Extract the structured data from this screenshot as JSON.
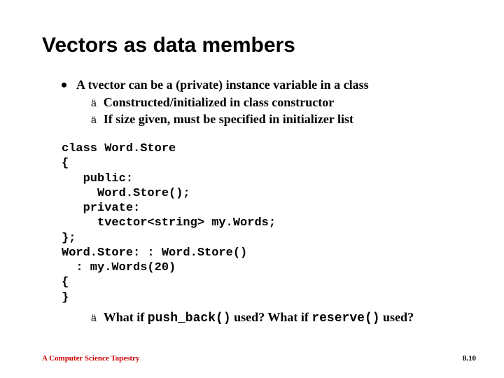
{
  "title": "Vectors as data members",
  "bullets": {
    "main": "A tvector can be a (private) instance variable in a class",
    "sub1": "Constructed/initialized in class constructor",
    "sub2": "If size given, must be specified in initializer list"
  },
  "code": "class Word.Store\n{\n   public:\n     Word.Store();\n   private:\n     tvector<string> my.Words;\n};\nWord.Store: : Word.Store()\n  : my.Words(20)\n{\n}",
  "question": {
    "prefix": "What if ",
    "code1": "push_back()",
    "mid": " used? What if ",
    "code2": "reserve()",
    "suffix": " used?"
  },
  "footer": {
    "left": "A Computer Science Tapestry",
    "right": "8.10"
  }
}
